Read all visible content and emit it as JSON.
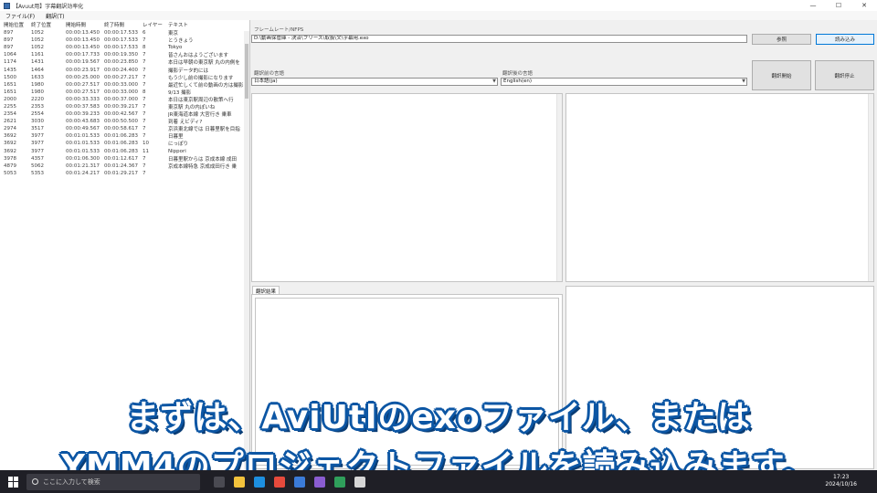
{
  "window": {
    "title": "【Avuut用】字幕翻訳効率化"
  },
  "menu": [
    "ファイル(F)",
    "翻訳(T)"
  ],
  "list": {
    "headers": [
      "開始位置",
      "終了位置",
      "開始時間",
      "終了時間",
      "レイヤー",
      "テキスト"
    ],
    "rows": [
      [
        "897",
        "1052",
        "00:00:13.450",
        "00:00:17.533",
        "6",
        "東京"
      ],
      [
        "897",
        "1052",
        "00:00:13.450",
        "00:00:17.533",
        "7",
        "とうきょう"
      ],
      [
        "897",
        "1052",
        "00:00:13.450",
        "00:00:17.533",
        "8",
        "Tokyo"
      ],
      [
        "1064",
        "1161",
        "00:00:17.733",
        "00:00:19.350",
        "7",
        "皆さんおはようございます"
      ],
      [
        "1174",
        "1431",
        "00:00:19.567",
        "00:00:23.850",
        "7",
        "本日は早朝の東京駅 丸の内側を"
      ],
      [
        "1435",
        "1464",
        "00:00:23.917",
        "00:00:24.400",
        "7",
        "撮影データ的には"
      ],
      [
        "1500",
        "1633",
        "00:00:25.000",
        "00:00:27.217",
        "7",
        "もう少し前の撮影になります"
      ],
      [
        "1651",
        "1980",
        "00:00:27.517",
        "00:00:33.000",
        "7",
        "最近忙しくて前の動画の方は撮影"
      ],
      [
        "1651",
        "1980",
        "00:00:27.517",
        "00:00:33.000",
        "8",
        "9/13 撮影"
      ],
      [
        "2000",
        "2220",
        "00:00:33.333",
        "00:00:37.000",
        "7",
        "本日は東京駅周辺の散策へ行"
      ],
      [
        "2255",
        "2353",
        "00:00:37.583",
        "00:00:39.217",
        "7",
        "東京駅 丸の内ぽいね"
      ],
      [
        "2354",
        "2554",
        "00:00:39.233",
        "00:00:42.567",
        "7",
        "JR東海道本線 大宮行き 乗車"
      ],
      [
        "2621",
        "3030",
        "00:00:43.683",
        "00:00:50.500",
        "7",
        "到着 えビディ?"
      ],
      [
        "2974",
        "3517",
        "00:00:49.567",
        "00:00:58.617",
        "7",
        "京浜東北線では 日暮里駅を目指"
      ],
      [
        "3692",
        "3977",
        "00:01:01.533",
        "00:01:06.283",
        "7",
        "日暮里"
      ],
      [
        "3692",
        "3977",
        "00:01:01.533",
        "00:01:06.283",
        "10",
        "にっぽり"
      ],
      [
        "3692",
        "3977",
        "00:01:01.533",
        "00:01:06.283",
        "11",
        "Nippori"
      ],
      [
        "3978",
        "4357",
        "00:01:06.300",
        "00:01:12.617",
        "7",
        "日暮里駅からは 京成本線 成田"
      ],
      [
        "4879",
        "5062",
        "00:01:21.317",
        "00:01:24.367",
        "7",
        "京成本線特急 京成成田行き 乗"
      ],
      [
        "5053",
        "5353",
        "00:01:24.217",
        "00:01:29.217",
        "7",
        ""
      ]
    ]
  },
  "form": {
    "frame_label": "フレームレート/NFPS",
    "file_path": "D:\\動画保管庫 - 決済\\フリーズ\\取扱\\文\\字幕用.exo",
    "browse_button": "参照",
    "load_button": "読み込み",
    "source_lang_label": "翻訳前の言語",
    "source_lang_value": "日本語(ja)",
    "target_lang_label": "翻訳後の言語",
    "target_lang_value": "English(en)",
    "translate_start": "翻訳開始",
    "translate_stop": "翻訳停止",
    "result_tab": "翻訳結果"
  },
  "subtitles": {
    "line1": "まずは、AviUtlのexoファイル、または",
    "line2": "YMM4のプロジェクトファイルを読み込みます。"
  },
  "taskbar": {
    "search_placeholder": "ここに入力して検索",
    "time": "17:23",
    "date": "2024/10/16"
  }
}
